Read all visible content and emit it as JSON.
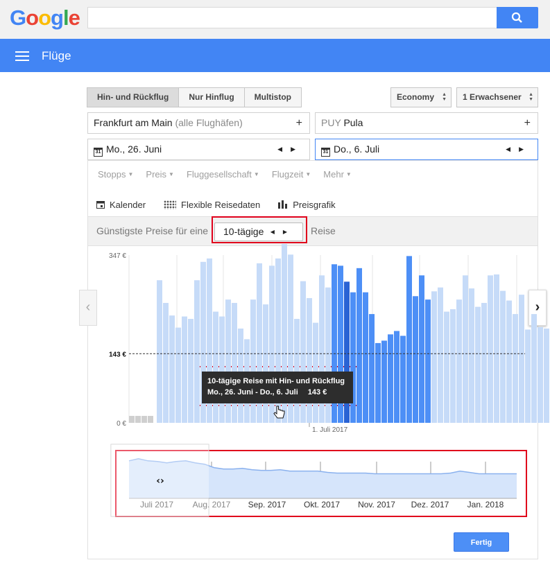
{
  "header": {
    "logo_letters": [
      "G",
      "o",
      "o",
      "g",
      "l",
      "e"
    ],
    "logo_colors": [
      "#4285f4",
      "#ea4335",
      "#fbbc05",
      "#4285f4",
      "#34a853",
      "#ea4335"
    ],
    "search_icon": "search-icon",
    "app_title": "Flüge"
  },
  "trip_types": {
    "round": "Hin- und Rückflug",
    "oneway": "Nur Hinflug",
    "multi": "Multistop",
    "active": "round"
  },
  "cabin_class": "Economy",
  "passengers": "1 Erwachsener",
  "origin": {
    "name": "Frankfurt am Main",
    "suffix": "(alle Flughäfen)"
  },
  "destination": {
    "code": "PUY",
    "name": "Pula"
  },
  "dates": {
    "depart": "Mo., 26. Juni",
    "return": "Do., 6. Juli",
    "cal_icon_text": "31"
  },
  "filters": [
    "Stopps",
    "Preis",
    "Fluggesellschaft",
    "Flugzeit",
    "Mehr"
  ],
  "views": {
    "calendar": "Kalender",
    "flexible": "Flexible Reisedaten",
    "chart": "Preisgrafik",
    "active": "chart"
  },
  "duration": {
    "prefix": "Günstigste Preise für eine",
    "value": "10-tägige",
    "suffix": "Reise"
  },
  "tooltip": {
    "line1": "10-tägige Reise mit Hin- und Rückflug",
    "dates": "Mo., 26. Juni - Do., 6. Juli",
    "price": "143 €"
  },
  "accent_color": "#4285f4",
  "chart_data": {
    "type": "bar",
    "title": "",
    "ylim": [
      0,
      347
    ],
    "y_ticks": [
      "347 €",
      "143 €",
      "0 €"
    ],
    "reference_line": {
      "value": 143,
      "label": "143 €",
      "style": "dashed"
    },
    "x_marker_label": "1. Juli 2017",
    "unavailable_bars": 4,
    "values": [
      295,
      248,
      222,
      197,
      220,
      215,
      295,
      333,
      340,
      230,
      220,
      255,
      248,
      195,
      173,
      255,
      330,
      245,
      325,
      340,
      370,
      348,
      215,
      293,
      258,
      207,
      305,
      280,
      328,
      325,
      292,
      270,
      320,
      270,
      225,
      165,
      170,
      183,
      190,
      180,
      345,
      262,
      305,
      255,
      272,
      280,
      230,
      235,
      255,
      305,
      278,
      240,
      248,
      305,
      307,
      273,
      253,
      225,
      265,
      193,
      225,
      198,
      195
    ],
    "bar_states": "p:0-27,d:28-29,s:30,d:31-43,p:44-62",
    "colors": {
      "light": "#c6dbf8",
      "mid": "#4d8ff6",
      "selected": "#2a63d4",
      "unavailable": "#cfcfcf"
    },
    "grid": true
  },
  "overview_chart": {
    "type": "area",
    "x_labels": [
      "Juli 2017",
      "Aug. 2017",
      "Sep. 2017",
      "Okt. 2017",
      "Nov. 2017",
      "Dez. 2017",
      "Jan. 2018"
    ],
    "values": [
      55,
      58,
      55,
      54,
      52,
      54,
      55,
      52,
      50,
      45,
      43,
      43,
      44,
      42,
      41,
      41,
      42,
      40,
      40,
      40,
      40,
      38,
      37,
      37,
      37,
      37,
      36,
      36,
      36,
      36,
      36,
      36,
      36,
      36,
      37,
      40,
      38,
      36,
      36,
      36,
      36,
      36
    ],
    "window_handle_icon": "chevrons-left-right-icon"
  },
  "done_button": "Fertig",
  "nav": {
    "prev_icon": "chevron-left-icon",
    "next_icon": "chevron-right-icon"
  }
}
